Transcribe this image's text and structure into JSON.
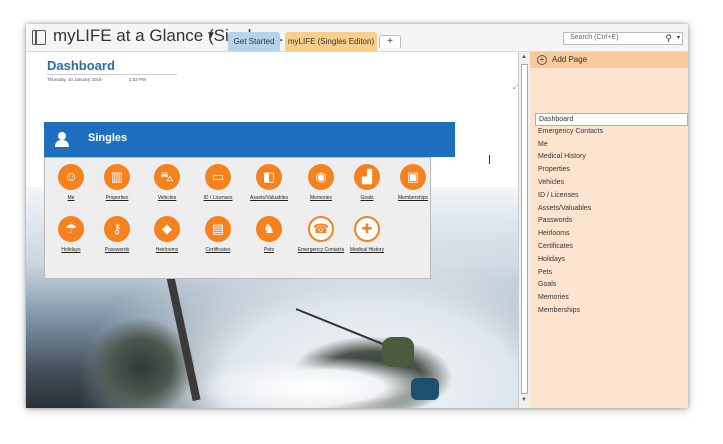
{
  "notebook": {
    "title": "myLIFE at a Glance (Singles ...",
    "caret": "▼"
  },
  "tabs": [
    {
      "label": "Get Started",
      "color": "#b7d3ec"
    },
    {
      "label": "myLIFE (Singles Editon)",
      "color": "#f8cf8a"
    },
    {
      "label": "+"
    }
  ],
  "search": {
    "placeholder": "Search (Ctrl+E)",
    "icon": "search-icon"
  },
  "page": {
    "title": "Dashboard",
    "date": "Thursday, 10 January 2019",
    "time": "1:52 PM"
  },
  "panel": {
    "title": "Singles",
    "header_color": "#1f6fbf",
    "accent": "#f5821f",
    "row1": [
      {
        "label": "Me",
        "icon": "people-icon",
        "glyph": "☺"
      },
      {
        "label": "Properties",
        "icon": "building-icon",
        "glyph": "▥"
      },
      {
        "label": "Vehicles",
        "icon": "car-icon",
        "glyph": "⛍"
      },
      {
        "label": "ID / Licenses",
        "icon": "id-card-icon",
        "glyph": "▭"
      },
      {
        "label": "Assets/Valuables",
        "icon": "wallet-icon",
        "glyph": "◧"
      },
      {
        "label": "Memories",
        "icon": "photo-icon",
        "glyph": "◉"
      },
      {
        "label": "Goals",
        "icon": "podium-icon",
        "glyph": "▟"
      },
      {
        "label": "Memberships",
        "icon": "membership-icon",
        "glyph": "▣"
      }
    ],
    "row2": [
      {
        "label": "Holidays",
        "icon": "beach-icon",
        "glyph": "☂"
      },
      {
        "label": "Passwords",
        "icon": "key-icon",
        "glyph": "⚷"
      },
      {
        "label": "Heirlooms",
        "icon": "diamond-icon",
        "glyph": "◆"
      },
      {
        "label": "Certificates",
        "icon": "certificate-icon",
        "glyph": "▤"
      },
      {
        "label": "Pets",
        "icon": "dog-icon",
        "glyph": "♞"
      },
      {
        "label": "Emergency Contacts",
        "icon": "phone-icon",
        "glyph": "☎"
      },
      {
        "label": "Medical History",
        "icon": "medical-kit-icon",
        "glyph": "✚"
      }
    ]
  },
  "sidebar": {
    "add_page": "Add Page",
    "items": [
      "Dashboard",
      "Emergency Contacts",
      "Me",
      "Medical History",
      "Properties",
      "Vehicles",
      "ID / Licenses",
      "Assets/Valuables",
      "Passwords",
      "Heirlooms",
      "Certificates",
      "Holidays",
      "Pets",
      "Goals",
      "Memories",
      "Memberships"
    ],
    "selected": "Dashboard"
  }
}
